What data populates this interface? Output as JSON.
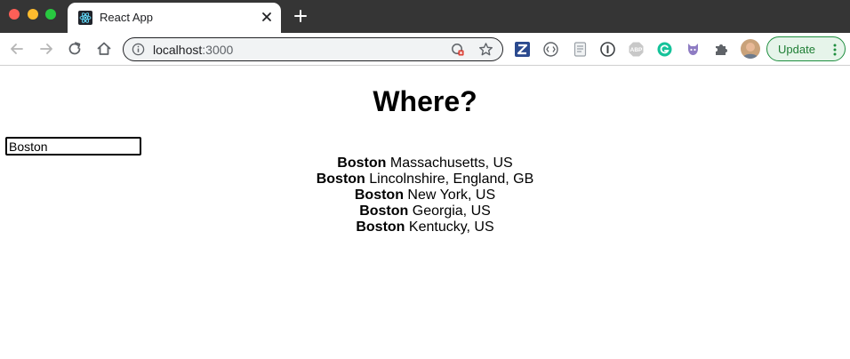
{
  "browser": {
    "tab": {
      "title": "React App",
      "favicon": "react-logo-icon"
    },
    "address": {
      "host": "localhost",
      "port": ":3000"
    },
    "update_label": "Update",
    "extensions": [
      "zotero-icon",
      "code-icon",
      "doc-icon",
      "onepassword-icon",
      "adblock-plus-icon",
      "grammarly-icon",
      "octocat-icon",
      "puzzle-icon"
    ],
    "colors": {
      "titlebar": "#353535",
      "update_accent": "#1e8e3e"
    }
  },
  "page": {
    "heading": "Where?",
    "search": {
      "value": "Boston"
    },
    "results": [
      {
        "city": "Boston",
        "place": "Massachusetts, US"
      },
      {
        "city": "Boston",
        "place": "Lincolnshire, England, GB"
      },
      {
        "city": "Boston",
        "place": "New York, US"
      },
      {
        "city": "Boston",
        "place": "Georgia, US"
      },
      {
        "city": "Boston",
        "place": "Kentucky, US"
      }
    ]
  }
}
